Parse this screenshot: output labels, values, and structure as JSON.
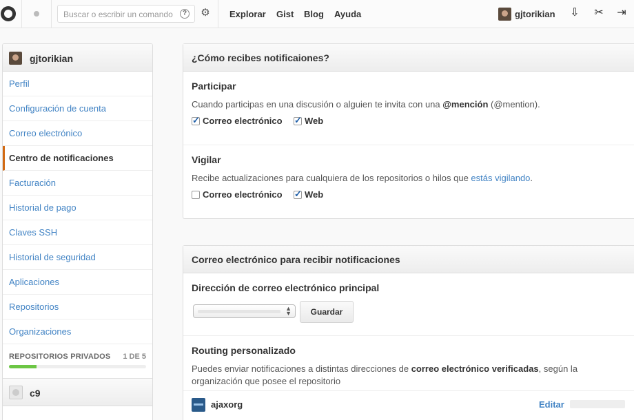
{
  "header": {
    "search_placeholder": "Buscar o escribir un comando",
    "help_glyph": "?",
    "nav": [
      "Explorar",
      "Gist",
      "Blog",
      "Ayuda"
    ],
    "username": "gjtorikian"
  },
  "sidebar": {
    "username": "gjtorikian",
    "items": [
      {
        "label": "Perfil"
      },
      {
        "label": "Configuración de cuenta"
      },
      {
        "label": "Correo electrónico"
      },
      {
        "label": "Centro de notificaciones",
        "active": true
      },
      {
        "label": "Facturación"
      },
      {
        "label": "Historial de pago"
      },
      {
        "label": "Claves SSH"
      },
      {
        "label": "Historial de seguridad"
      },
      {
        "label": "Aplicaciones"
      },
      {
        "label": "Repositorios"
      },
      {
        "label": "Organizaciones"
      }
    ],
    "private_repos": {
      "label": "REPOSITORIOS PRIVADOS",
      "count": "1 DE 5",
      "fraction": 0.2
    },
    "org": "c9"
  },
  "notifications": {
    "title": "¿Cómo recibes notificaiones?",
    "participate": {
      "title": "Participar",
      "desc_before": "Cuando participas en una discusión o alguien te invita con una ",
      "desc_bold": "@mención",
      "desc_after": " (@mention).",
      "email_label": "Correo electrónico",
      "email_checked": true,
      "web_label": "Web",
      "web_checked": true
    },
    "watch": {
      "title": "Vigilar",
      "desc_before": "Recibe actualizaciones para cualquiera de los repositorios o hilos que ",
      "desc_link": "estás vigilando",
      "desc_after": ".",
      "email_label": "Correo electrónico",
      "email_checked": false,
      "web_label": "Web",
      "web_checked": true
    }
  },
  "email": {
    "title": "Correo electrónico para recibir notificaciones",
    "primary": {
      "title": "Dirección de correo electrónico principal",
      "save_label": "Guardar"
    },
    "routing": {
      "title": "Routing personalizado",
      "desc_before": "Puedes enviar notificaciones a distintas direcciones de ",
      "desc_bold": "correo electrónico verificadas",
      "desc_after": ", según la organización que posee el repositorio",
      "org_name": "ajaxorg",
      "edit_label": "Editar"
    }
  },
  "colors": {
    "link": "#4183c4",
    "active_marker": "#d26911",
    "progress": "#6cc644"
  }
}
